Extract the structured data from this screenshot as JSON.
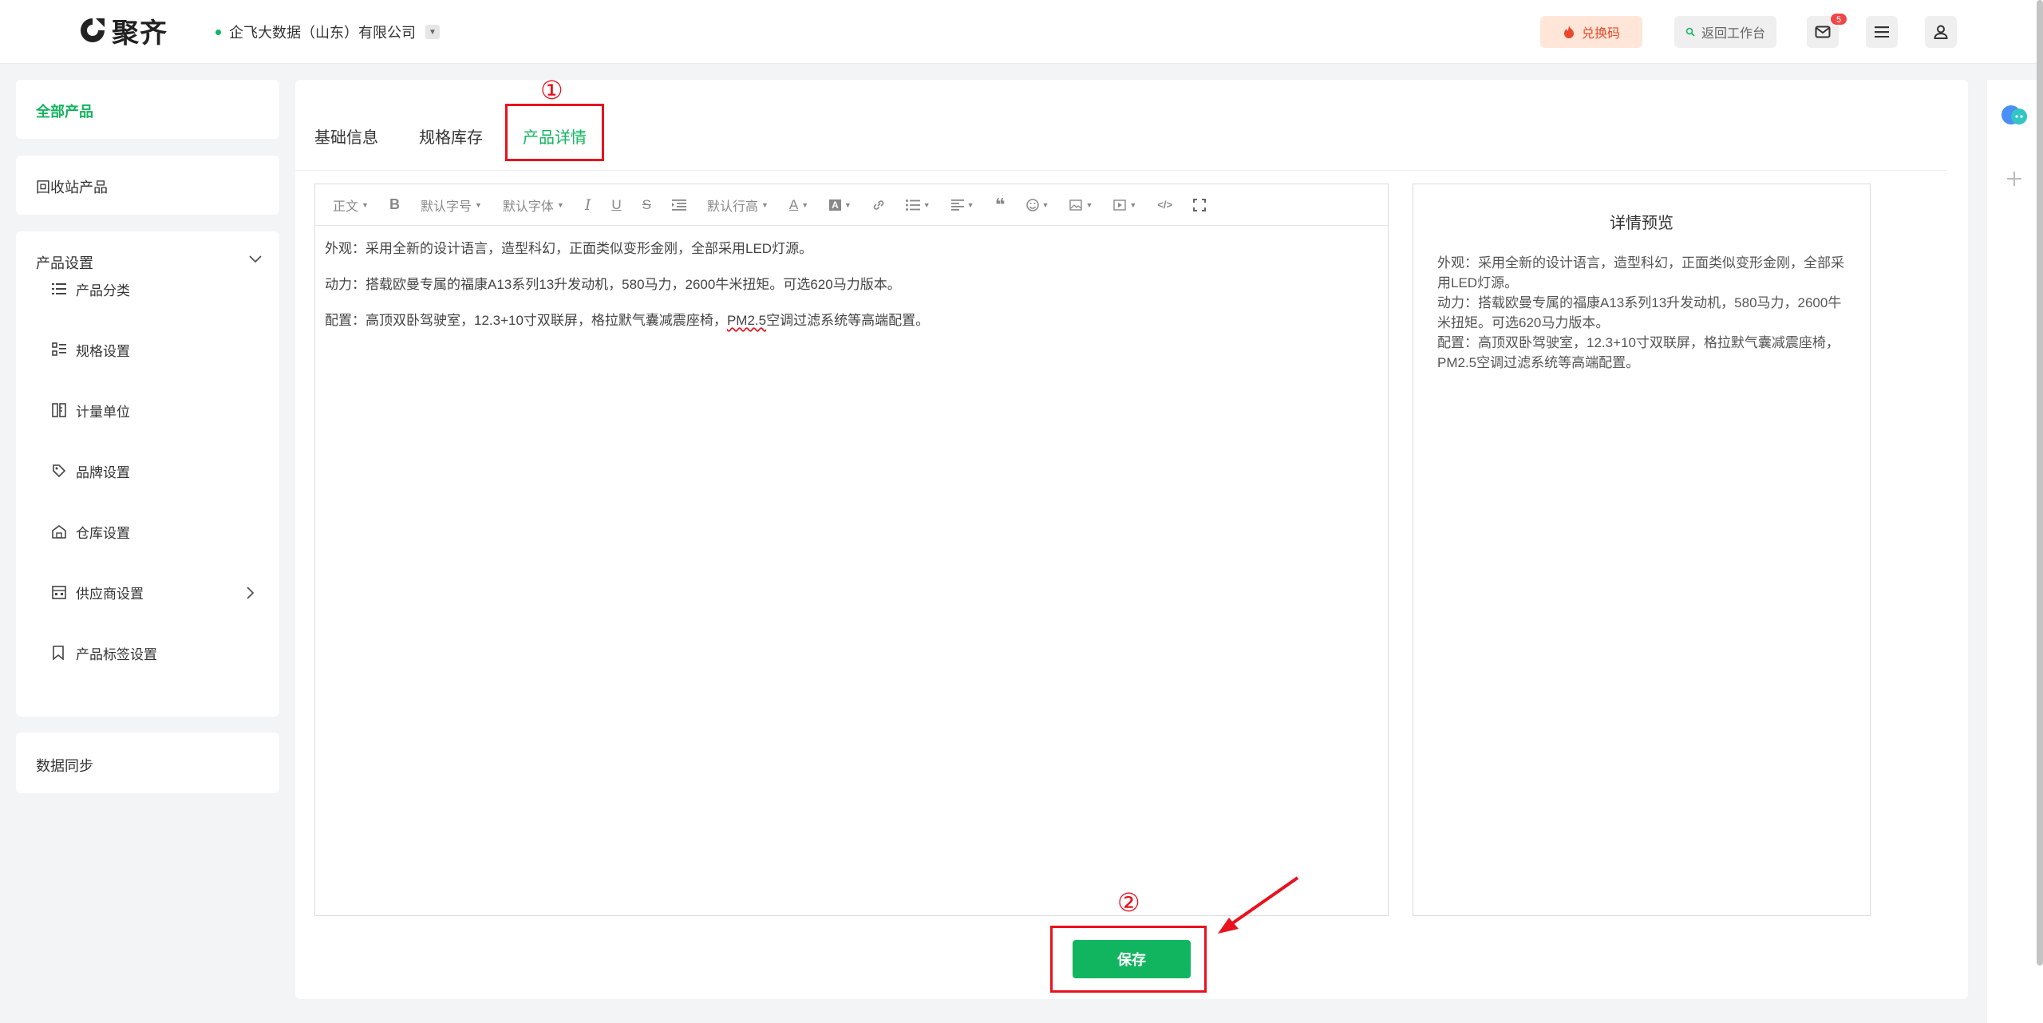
{
  "header": {
    "logo_text": "聚齐",
    "company": "企飞大数据（山东）有限公司",
    "redeem_label": "兑换码",
    "return_label": "返回工作台",
    "mail_badge": "5"
  },
  "sidebar": {
    "all_products": "全部产品",
    "recycle_products": "回收站产品",
    "product_settings": {
      "title": "产品设置",
      "items": [
        {
          "label": "产品分类",
          "icon": "list-icon"
        },
        {
          "label": "规格设置",
          "icon": "spec-icon"
        },
        {
          "label": "计量单位",
          "icon": "unit-icon"
        },
        {
          "label": "品牌设置",
          "icon": "tag-icon"
        },
        {
          "label": "仓库设置",
          "icon": "warehouse-icon"
        },
        {
          "label": "供应商设置",
          "icon": "supplier-icon"
        },
        {
          "label": "产品标签设置",
          "icon": "bookmark-icon"
        }
      ]
    },
    "data_sync": "数据同步"
  },
  "tabs": [
    "基础信息",
    "规格库存",
    "产品详情"
  ],
  "active_tab": "产品详情",
  "annotations": {
    "step1": "①",
    "step2": "②"
  },
  "toolbar": {
    "paragraph": "正文",
    "font_size": "默认字号",
    "font_family": "默认字体",
    "line_height": "默认行高"
  },
  "editor": {
    "lines": [
      "外观：采用全新的设计语言，造型科幻，正面类似变形金刚，全部采用LED灯源。",
      "动力：搭载欧曼专属的福康A13系列13升发动机，580马力，2600牛米扭矩。可选620马力版本。",
      "配置：高顶双卧驾驶室，12.3+10寸双联屏，格拉默气囊减震座椅，"
    ],
    "line3_misspelled": "PM2.5",
    "line3_rest": "空调过滤系统等高端配置。"
  },
  "preview": {
    "title": "详情预览",
    "lines": [
      "外观：采用全新的设计语言，造型科幻，正面类似变形金刚，全部采用LED灯源。",
      "动力：搭载欧曼专属的福康A13系列13升发动机，580马力，2600牛米扭矩。可选620马力版本。",
      "配置：高顶双卧驾驶室，12.3+10寸双联屏，格拉默气囊减震座椅，PM2.5空调过滤系统等高端配置。"
    ]
  },
  "save_label": "保存",
  "colors": {
    "accent": "#12b55f",
    "highlight": "#e8121d"
  }
}
